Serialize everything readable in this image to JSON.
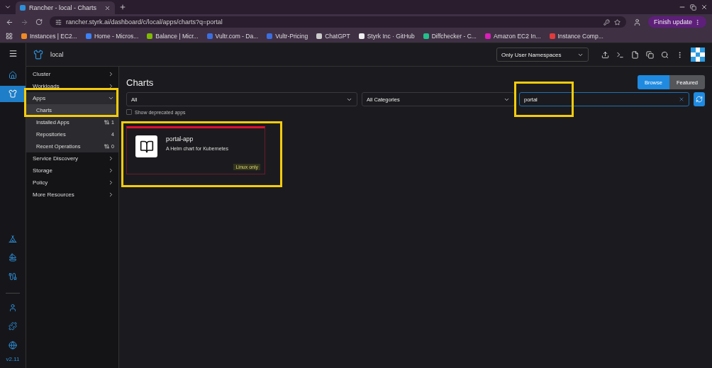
{
  "browser": {
    "tab": {
      "title": "Rancher - local - Charts"
    },
    "url": "rancher.styrk.ai/dashboard/c/local/apps/charts?q=portal",
    "bookmarks": [
      {
        "label": "Instances | EC2...",
        "color": "#f08a24"
      },
      {
        "label": "Home - Micros...",
        "color": "#3b82f6"
      },
      {
        "label": "Balance | Micr...",
        "color": "#7fba00"
      },
      {
        "label": "Vultr.com - Da...",
        "color": "#3b6fe0"
      },
      {
        "label": "Vultr-Pricing",
        "color": "#3b6fe0"
      },
      {
        "label": "ChatGPT",
        "color": "#cccccc"
      },
      {
        "label": "Styrk Inc · GitHub",
        "color": "#eeeeee"
      },
      {
        "label": "Diffchecker - C...",
        "color": "#22c08a"
      },
      {
        "label": "Amazon EC2 In...",
        "color": "#d91fb8"
      },
      {
        "label": "Instance Comp...",
        "color": "#e23b3b"
      }
    ],
    "update_button": "Finish update"
  },
  "app": {
    "cluster": "local",
    "namespace_filter": "Only User Namespaces",
    "rail": [
      {
        "kind": "home",
        "selected": false
      },
      {
        "kind": "cluster",
        "selected": true
      },
      {
        "kind": "fleet",
        "selected": false
      },
      {
        "kind": "sail",
        "selected": false
      },
      {
        "kind": "plug",
        "selected": false
      },
      {
        "kind": "user",
        "selected": false
      },
      {
        "kind": "puzzle",
        "selected": false
      },
      {
        "kind": "globe",
        "selected": false
      }
    ],
    "version": "v2.11",
    "nav": [
      {
        "label": "Cluster",
        "expanded": false
      },
      {
        "label": "Workloads",
        "expanded": false
      },
      {
        "label": "Apps",
        "expanded": true,
        "children": [
          {
            "label": "Charts",
            "selected": true
          },
          {
            "label": "Installed Apps",
            "count": "1",
            "kind": "helm"
          },
          {
            "label": "Repositories",
            "count": "4",
            "kind": "plain"
          },
          {
            "label": "Recent Operations",
            "count": "0",
            "kind": "helm"
          }
        ]
      },
      {
        "label": "Service Discovery",
        "expanded": false
      },
      {
        "label": "Storage",
        "expanded": false
      },
      {
        "label": "Policy",
        "expanded": false
      },
      {
        "label": "More Resources",
        "expanded": false
      }
    ],
    "page_title": "Charts",
    "view_toggle": [
      {
        "label": "Browse",
        "selected": true
      },
      {
        "label": "Featured",
        "selected": false
      }
    ],
    "repo_filter": "All",
    "category_filter": "All Categories",
    "search": {
      "value": "portal"
    },
    "deprecated": {
      "label": "Show deprecated apps",
      "checked": false
    },
    "charts": [
      {
        "name": "portal-app",
        "description": "A Helm chart for Kubernetes",
        "badge": "Linux only"
      }
    ]
  }
}
